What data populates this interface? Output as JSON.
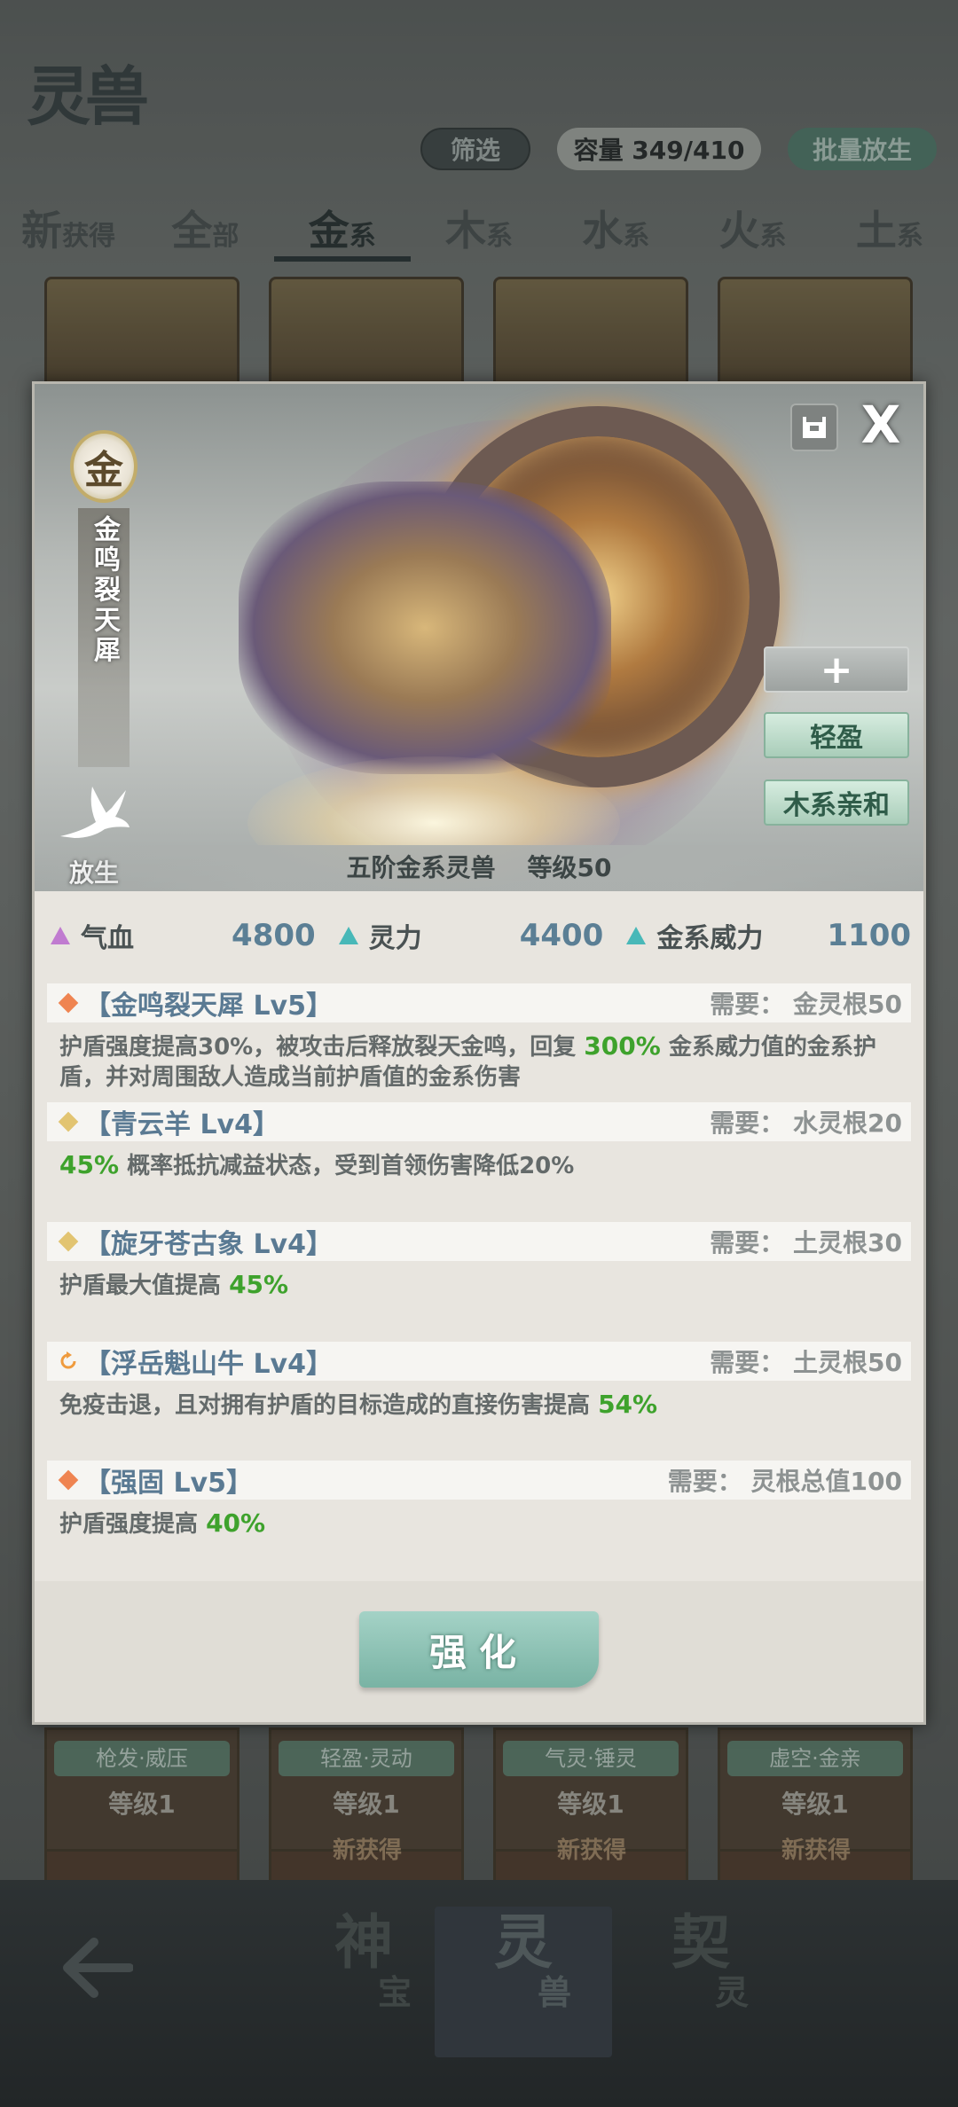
{
  "background": {
    "logo": "灵兽",
    "filter_label": "筛选",
    "capacity_label": "容量 349/410",
    "batch_release_label": "批量放生",
    "tabs": [
      {
        "big": "新",
        "small": "获得"
      },
      {
        "big": "全",
        "small": "部"
      },
      {
        "big": "金",
        "small": "系"
      },
      {
        "big": "木",
        "small": "系"
      },
      {
        "big": "水",
        "small": "系"
      },
      {
        "big": "火",
        "small": "系"
      },
      {
        "big": "土",
        "small": "系"
      }
    ],
    "cards_row2": [
      {
        "tag": "枪发·威压",
        "level": "等级1"
      },
      {
        "tag": "轻盈·灵动",
        "level": "等级1"
      },
      {
        "tag": "气灵·锤灵",
        "level": "等级1"
      },
      {
        "tag": "虚空·金亲",
        "level": "等级1"
      }
    ],
    "new_tag": "新获得",
    "nav": [
      {
        "big": "神",
        "small": "宝"
      },
      {
        "big": "灵",
        "small": "兽"
      },
      {
        "big": "契",
        "small": "灵"
      }
    ]
  },
  "modal": {
    "element": "金",
    "beast_name": "金鸣裂天犀",
    "release_label": "放生",
    "close_glyph": "X",
    "plus_glyph": "+",
    "traits": [
      "轻盈",
      "木系亲和"
    ],
    "caption_rank": "五阶金系灵兽",
    "caption_level": "等级50",
    "stats": [
      {
        "label": "气血",
        "value": "4800",
        "color": "purple"
      },
      {
        "label": "灵力",
        "value": "4400",
        "color": "cyan"
      },
      {
        "label": "金系威力",
        "value": "1100",
        "color": "cyan"
      }
    ],
    "skills": [
      {
        "name": "【金鸣裂天犀 Lv5】",
        "req": "需要： 金灵根50",
        "desc_pre": "护盾强度提高30%，被攻击后释放裂天金鸣，回复 ",
        "desc_hl": "300%",
        "desc_post": " 金系威力值的金系护盾，并对周围敌人造成当前护盾值的金系伤害"
      },
      {
        "name": "【青云羊 Lv4】",
        "req": "需要： 水灵根20",
        "desc_pre": "",
        "desc_hl": "45%",
        "desc_post": " 概率抵抗减益状态，受到首领伤害降低20%"
      },
      {
        "name": "【旋牙苍古象 Lv4】",
        "req": "需要： 土灵根30",
        "desc_pre": "护盾最大值提高 ",
        "desc_hl": "45%",
        "desc_post": ""
      },
      {
        "name": "【浮岳魁山牛 Lv4】",
        "req": "需要： 土灵根50",
        "desc_pre": "免疫击退，且对拥有护盾的目标造成的直接伤害提高 ",
        "desc_hl": "54%",
        "desc_post": ""
      },
      {
        "name": "【强固 Lv5】",
        "req": "需要： 灵根总值100",
        "desc_pre": "护盾强度提高 ",
        "desc_hl": "40%",
        "desc_post": ""
      }
    ],
    "enhance_label": "强化"
  },
  "colors": {
    "highlight_green": "#3ea22c",
    "skill_name_blue": "#5a7a93",
    "enhance_teal": "#79b3a4"
  }
}
